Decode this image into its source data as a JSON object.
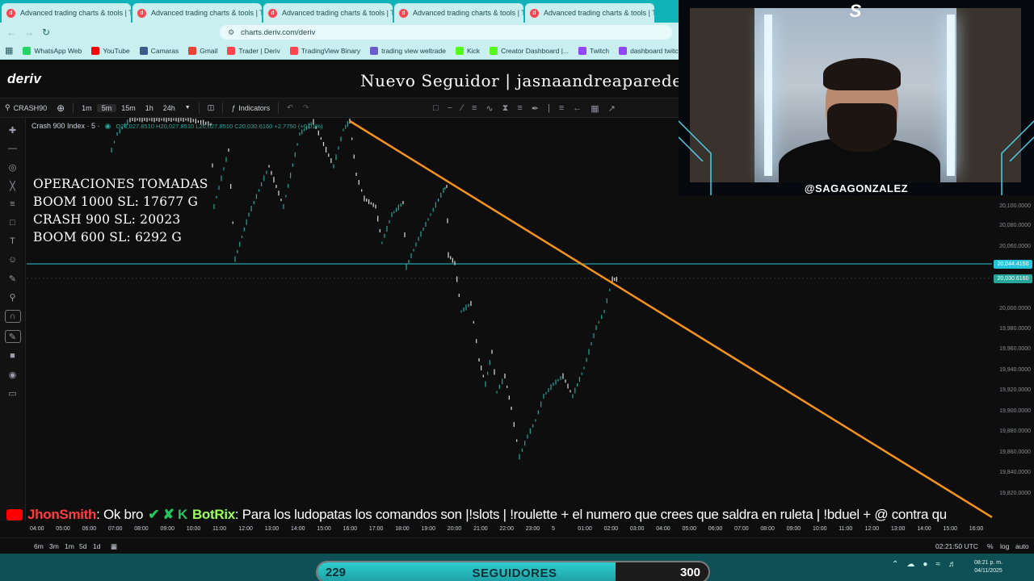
{
  "browser": {
    "tabs": [
      {
        "title": "Advanced trading charts & tools | Tr"
      },
      {
        "title": "Advanced trading charts & tools | Tr"
      },
      {
        "title": "Advanced trading charts & tools | Tr"
      },
      {
        "title": "Advanced trading charts & tools | Tr"
      },
      {
        "title": "Advanced trading charts & tools | Tr"
      }
    ],
    "url": "charts.deriv.com/deriv",
    "bookmarks": [
      {
        "label": "WhatsApp Web",
        "color": "#25d366"
      },
      {
        "label": "YouTube",
        "color": "#ff0000"
      },
      {
        "label": "Camaras",
        "color": "#3b5b8a"
      },
      {
        "label": "Gmail",
        "color": "#ea4335"
      },
      {
        "label": "Trader | Deriv",
        "color": "#ff444f"
      },
      {
        "label": "TradingView Binary",
        "color": "#ff444f"
      },
      {
        "label": "trading view weltrade",
        "color": "#6a5acd"
      },
      {
        "label": "Kick",
        "color": "#53fc18"
      },
      {
        "label": "Creator Dashboard |...",
        "color": "#53fc18"
      },
      {
        "label": "Twitch",
        "color": "#9146ff"
      },
      {
        "label": "dashboard twitch",
        "color": "#9146ff"
      }
    ]
  },
  "header": {
    "logo": "deriv",
    "follower_alert": "Nuevo Seguidor | jasnaandreaparede"
  },
  "toolbar": {
    "symbol": "CRASH90",
    "timeframes": [
      "1m",
      "5m",
      "15m",
      "1h",
      "24h"
    ],
    "active_timeframe": "5m",
    "indicators_label": "Indicators"
  },
  "chart": {
    "legend_title": "Crash 900 Index · 5 ·",
    "legend_ohlc": "O20,027.8510 H20,027.8510 L20,027.8510 C20,030.6160 +2.7750 (+0.01%)",
    "operations": {
      "title": "OPERACIONES TOMADAS",
      "lines": [
        "BOOM 1000 SL: 17677 G",
        "CRASH 900 SL: 20023",
        "BOOM 600 SL: 6292 G"
      ]
    },
    "price_ticks": [
      "20,100.0000",
      "20,080.0000",
      "20,060.0000",
      "20,000.0000",
      "19,980.0000",
      "19,960.0000",
      "19,940.0000",
      "19,920.0000",
      "19,900.0000",
      "19,880.0000",
      "19,860.0000",
      "19,840.0000",
      "19,820.0000"
    ],
    "price_tags": [
      "20,044.4150",
      "20,030.6160"
    ],
    "time_ticks": [
      "04:00",
      "05:00",
      "06:00",
      "07:00",
      "08:00",
      "09:00",
      "10:00",
      "11:00",
      "12:00",
      "13:00",
      "14:00",
      "15:00",
      "16:00",
      "17:00",
      "18:00",
      "19:00",
      "20:00",
      "21:00",
      "22:00",
      "23:00",
      "5",
      "01:00",
      "02:00",
      "03:00",
      "04:00",
      "05:00",
      "06:00",
      "07:00",
      "08:00",
      "09:00",
      "10:00",
      "11:00",
      "12:00",
      "13:00",
      "14:00",
      "15:00",
      "16:00"
    ],
    "trend_color": "#f7931a",
    "level_color": "#26c6da"
  },
  "chat": {
    "user1": "JhonSmith",
    "msg1": ": Ok bro",
    "user2": "BotRix",
    "msg2": ": Para los ludopatas los comandos son |!slots | !roulette + el numero que crees que saldra en ruleta | !bduel + @ contra qu"
  },
  "bottom": {
    "ranges": [
      "6m",
      "3m",
      "1m",
      "5d",
      "1d"
    ],
    "clock": "02:21:50 UTC",
    "percent": "%",
    "log": "log",
    "auto": "auto"
  },
  "webcam": {
    "handle": "@SAGAGONZALEZ"
  },
  "taskbar": {
    "time": "08:21 p. m.",
    "date": "04/11/2025"
  },
  "goal": {
    "current": "229",
    "label": "SEGUIDORES",
    "target": "300",
    "progress": 0.763
  }
}
